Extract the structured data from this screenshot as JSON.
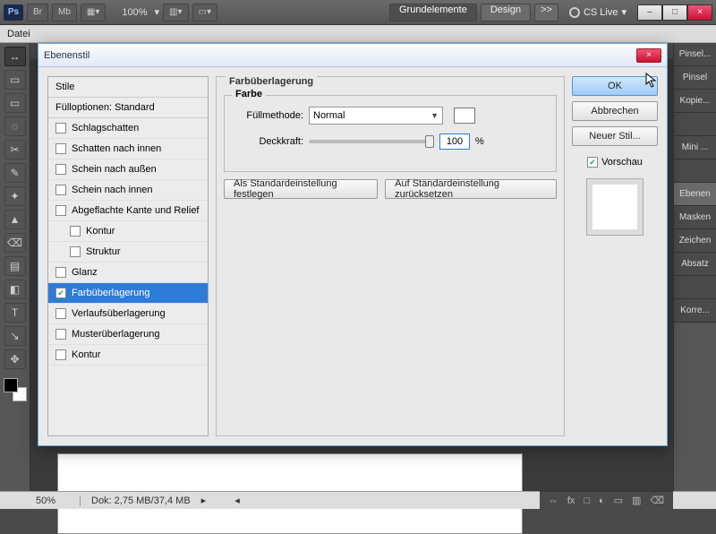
{
  "topbar": {
    "ps": "Ps",
    "br": "Br",
    "mb": "Mb",
    "zoom": "100%",
    "essentials": "Grundelemente",
    "design": "Design",
    "more": ">>",
    "cslive": "CS Live"
  },
  "winctl": {
    "min": "–",
    "max": "□",
    "close": "×"
  },
  "menubar": {
    "file": "Datei"
  },
  "tools": [
    "↔",
    "▭",
    "▭",
    "◌",
    "✂",
    "✎",
    "✦",
    "▲",
    "⌫",
    "▤",
    "◧",
    "T",
    "↘",
    "✥"
  ],
  "rightTabs": [
    "Pinsel...",
    "Pinsel",
    "Kopie...",
    "",
    "Mini ...",
    "",
    "Ebenen",
    "Masken",
    "Zeichen",
    "Absatz",
    "",
    "Korre..."
  ],
  "rightTabActive": 6,
  "status": {
    "zoom": "50%",
    "doc": "Dok: 2,75 MB/37,4 MB"
  },
  "statusIcons": [
    "⇔",
    "fx",
    "□",
    "◐",
    "▭",
    "▥",
    "⌫"
  ],
  "dialog": {
    "title": "Ebenenstil",
    "close": "×",
    "styleHeader": "Stile",
    "fillOptions": "Fülloptionen: Standard",
    "styles": [
      {
        "label": "Schlagschatten",
        "indent": false,
        "checked": false
      },
      {
        "label": "Schatten nach innen",
        "indent": false,
        "checked": false
      },
      {
        "label": "Schein nach außen",
        "indent": false,
        "checked": false
      },
      {
        "label": "Schein nach innen",
        "indent": false,
        "checked": false
      },
      {
        "label": "Abgeflachte Kante und Relief",
        "indent": false,
        "checked": false
      },
      {
        "label": "Kontur",
        "indent": true,
        "checked": false
      },
      {
        "label": "Struktur",
        "indent": true,
        "checked": false
      },
      {
        "label": "Glanz",
        "indent": false,
        "checked": false
      },
      {
        "label": "Farbüberlagerung",
        "indent": false,
        "checked": true,
        "selected": true
      },
      {
        "label": "Verlaufsüberlagerung",
        "indent": false,
        "checked": false
      },
      {
        "label": "Musterüberlagerung",
        "indent": false,
        "checked": false
      },
      {
        "label": "Kontur",
        "indent": false,
        "checked": false
      }
    ],
    "groupTitle": "Farbüberlagerung",
    "innerGroup": "Farbe",
    "blendLabel": "Füllmethode:",
    "blendValue": "Normal",
    "opacityLabel": "Deckkraft:",
    "opacityValue": "100",
    "opacityUnit": "%",
    "btnDefault": "Als Standardeinstellung festlegen",
    "btnReset": "Auf Standardeinstellung zurücksetzen",
    "ok": "OK",
    "cancel": "Abbrechen",
    "newStyle": "Neuer Stil...",
    "preview": "Vorschau",
    "previewChecked": true
  }
}
